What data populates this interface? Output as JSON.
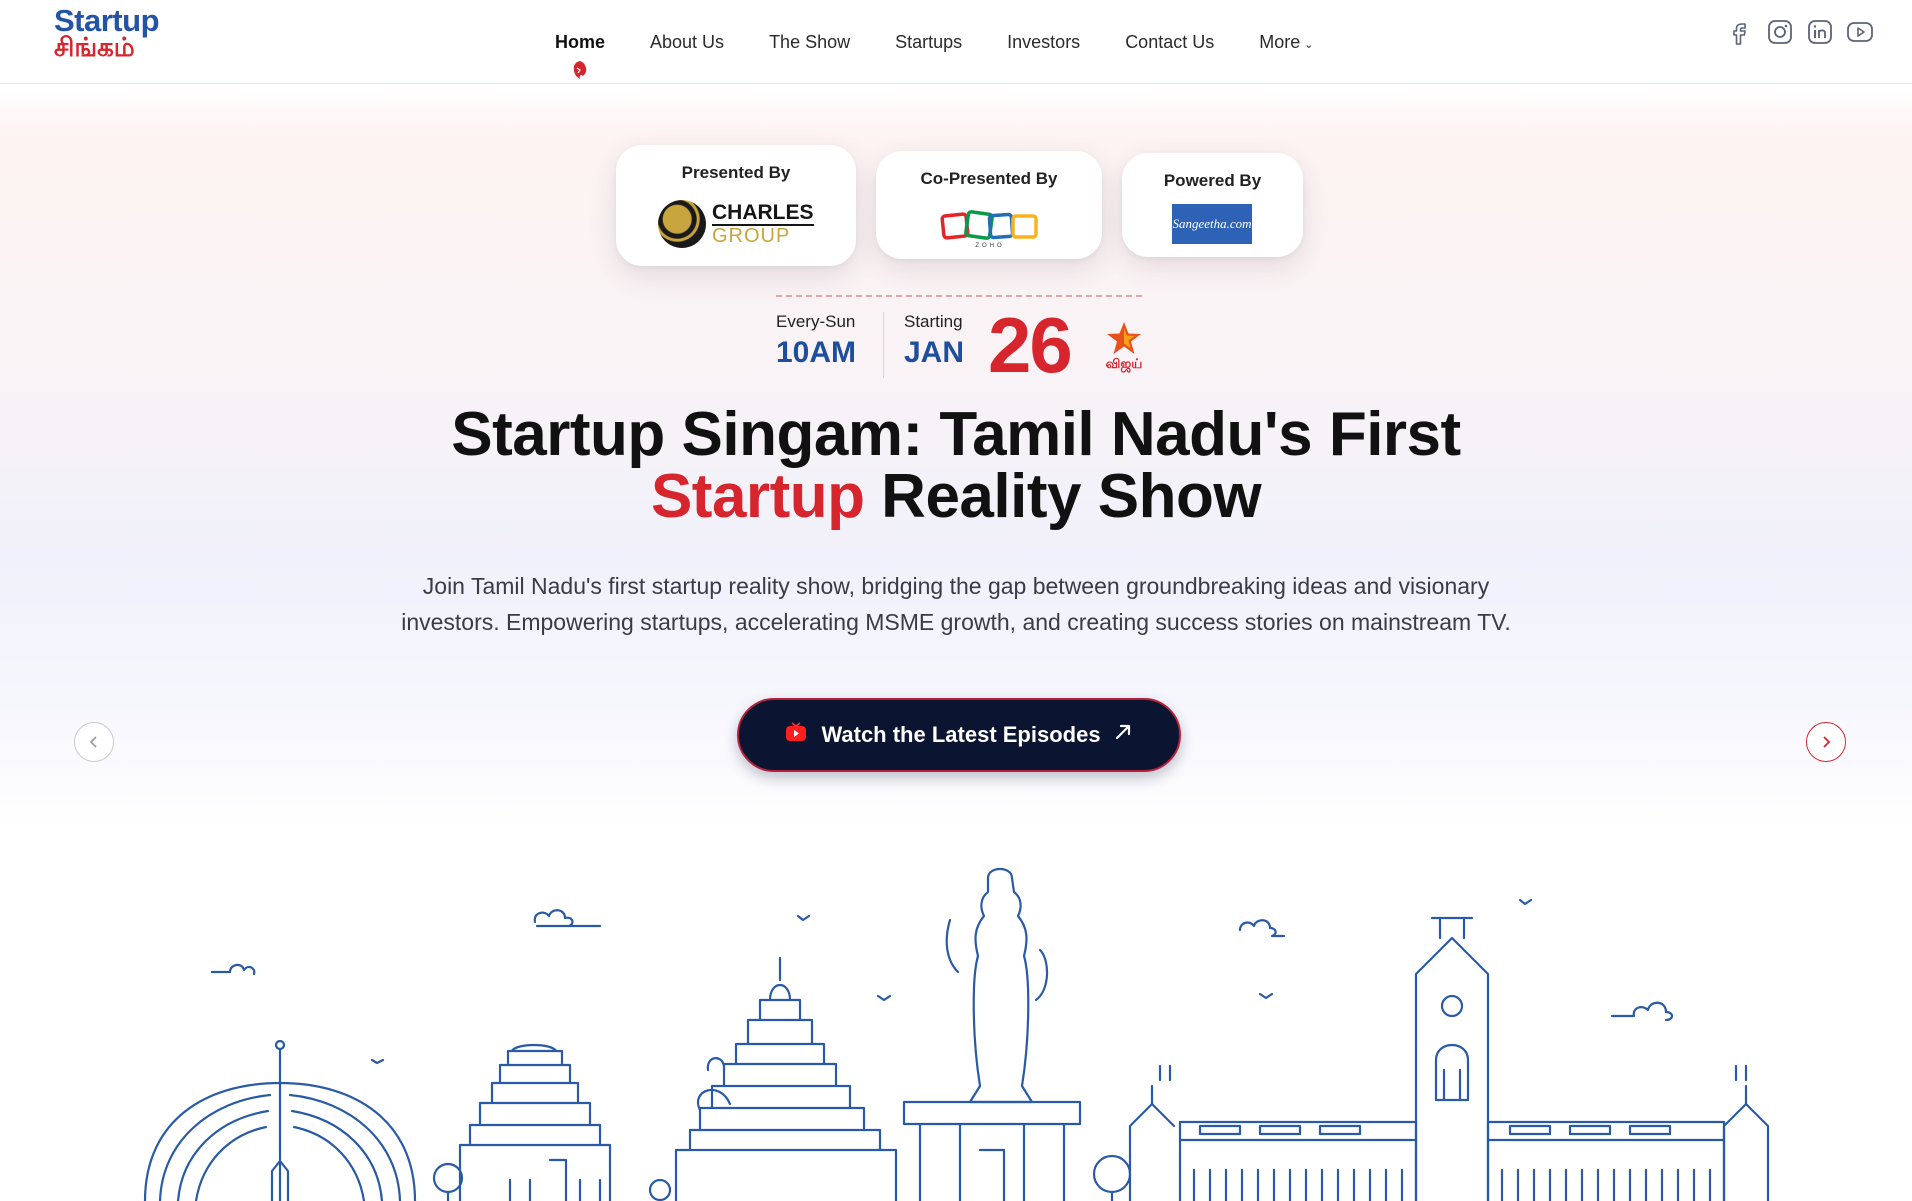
{
  "brand": {
    "logo_top": "Startup",
    "logo_bottom": "சிங்கம்"
  },
  "nav": {
    "items": [
      {
        "label": "Home",
        "active": true
      },
      {
        "label": "About Us"
      },
      {
        "label": "The Show"
      },
      {
        "label": "Startups"
      },
      {
        "label": "Investors"
      },
      {
        "label": "Contact Us"
      },
      {
        "label": "More"
      }
    ]
  },
  "socials": [
    "facebook-icon",
    "instagram-icon",
    "linkedin-icon",
    "youtube-icon"
  ],
  "sponsors": {
    "presented": {
      "title": "Presented By",
      "name": "CHARLES",
      "sub": "GROUP"
    },
    "copresented": {
      "title": "Co-Presented By",
      "name": "ZOHO"
    },
    "powered": {
      "title": "Powered By",
      "name": "Sangeetha.com"
    }
  },
  "schedule": {
    "day_label": "Every-Sun",
    "time": "10AM",
    "start_label": "Starting",
    "month": "JAN",
    "date": "26",
    "channel": "விஜய்"
  },
  "hero": {
    "title_line1": "Startup Singam: Tamil Nadu's First",
    "title_red": "Startup",
    "title_rest": " Reality Show",
    "description": "Join Tamil Nadu's first startup reality show, bridging the gap between groundbreaking ideas and visionary investors. Empowering startups, accelerating MSME growth, and creating success stories on mainstream TV.",
    "cta": "Watch the Latest Episodes"
  },
  "colors": {
    "brand_blue": "#2454a6",
    "brand_red": "#d6252d",
    "cta_bg": "#0b1430",
    "skyline_stroke": "#2a5aa6"
  }
}
